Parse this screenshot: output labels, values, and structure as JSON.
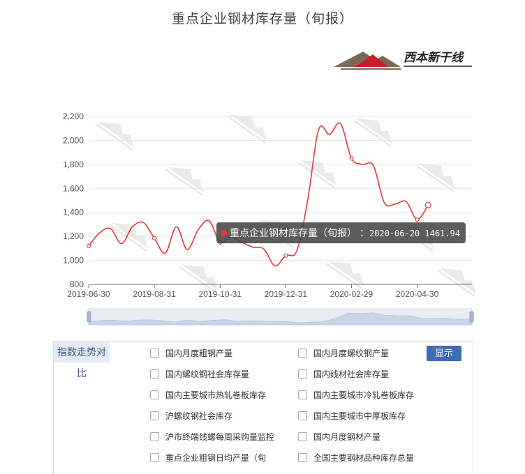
{
  "chart_data": {
    "type": "line",
    "title": "重点企业钢材库存量（旬报）",
    "x": [
      "2019-06-30",
      "2019-07-10",
      "2019-07-20",
      "2019-07-31",
      "2019-08-10",
      "2019-08-20",
      "2019-08-31",
      "2019-09-10",
      "2019-09-20",
      "2019-09-30",
      "2019-10-10",
      "2019-10-20",
      "2019-10-31",
      "2019-11-10",
      "2019-11-20",
      "2019-11-30",
      "2019-12-10",
      "2019-12-20",
      "2019-12-31",
      "2020-01-10",
      "2020-01-20",
      "2020-01-31",
      "2020-02-10",
      "2020-02-20",
      "2020-02-29",
      "2020-03-10",
      "2020-03-20",
      "2020-03-31",
      "2020-04-10",
      "2020-04-20",
      "2020-04-30",
      "2020-05-10",
      "2020-05-20",
      "2020-05-31",
      "2020-06-10",
      "2020-06-20"
    ],
    "series": [
      {
        "name": "重点企业钢材库存量（旬报）",
        "color": "#e03a3a",
        "values": [
          1120,
          1230,
          1265,
          1140,
          1280,
          1315,
          1185,
          1060,
          1280,
          1090,
          1255,
          1330,
          1150,
          1195,
          1150,
          1110,
          1095,
          955,
          1040,
          1080,
          1500,
          2090,
          2050,
          2140,
          1850,
          1800,
          1790,
          1480,
          1470,
          1490,
          1340,
          1462
        ]
      }
    ],
    "x_tick_labels": [
      "2019-06-30",
      "2019-08-31",
      "2019-10-31",
      "2019-12-31",
      "2020-02-29",
      "2020-04-30"
    ],
    "ylim": [
      800,
      2200
    ],
    "y_ticks": [
      800,
      1000,
      1200,
      1400,
      1600,
      1800,
      2000,
      2200
    ],
    "grid": true
  },
  "header": {
    "title": "重点企业钢材库存量（旬报）"
  },
  "logo": {
    "text": "西本新干线"
  },
  "tooltip": {
    "series_name": "重点企业钢材库存量（旬报）",
    "date": "2020-06-20",
    "value": "1461.94"
  },
  "panel": {
    "tab_label": "指数走势对比",
    "button_label": "显示",
    "options": [
      "国内月度粗钢产量",
      "国内月度螺纹钢产量",
      "国内螺纹钢社会库存量",
      "国内线材社会库存量",
      "国内主要城市热轧卷板库存",
      "国内主要城市冷轧卷板库存",
      "沪螺纹钢社会库存",
      "国内主要城市中厚板库存",
      "沪市终端线螺每周采购量监控",
      "国内月度钢材产量",
      "重点企业粗钢日均产量（旬",
      "全国主要钢材品种库存总量"
    ]
  }
}
